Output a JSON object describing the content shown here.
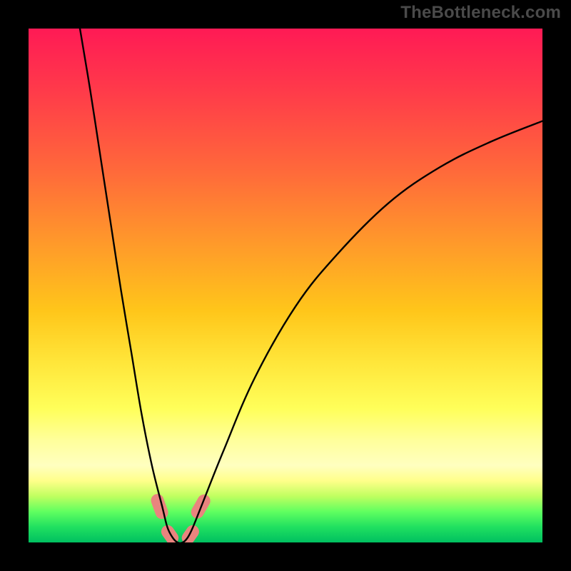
{
  "watermark": "TheBottleneck.com",
  "chart_data": {
    "type": "line",
    "title": "",
    "xlabel": "",
    "ylabel": "",
    "xlim": [
      0,
      100
    ],
    "ylim": [
      0,
      100
    ],
    "grid": false,
    "legend": false,
    "background_gradient": {
      "top_color": "#ff1a55",
      "mid_color": "#ffe63a",
      "bottom_color": "#00c060",
      "meaning": "red=high bottleneck, green=low bottleneck"
    },
    "series": [
      {
        "name": "bottleneck-curve",
        "color": "#000000",
        "x": [
          10,
          12,
          14,
          16,
          18,
          20,
          22,
          24,
          26,
          27,
          28,
          29,
          30,
          31,
          32,
          34,
          38,
          44,
          52,
          60,
          70,
          80,
          90,
          100
        ],
        "y": [
          100,
          88,
          75,
          62,
          49,
          37,
          25,
          15,
          7,
          3,
          1,
          0,
          0,
          1,
          3,
          8,
          18,
          32,
          46,
          56,
          66,
          73,
          78,
          82
        ]
      }
    ],
    "markers": [
      {
        "name": "highlight-left-slope",
        "shape": "round-bar",
        "color": "#e9847e",
        "x": 25.5,
        "y": 7,
        "angle_deg": 70,
        "length": 5
      },
      {
        "name": "highlight-valley-left",
        "shape": "round-bar",
        "color": "#e9847e",
        "x": 27.5,
        "y": 1.5,
        "angle_deg": 55,
        "length": 4
      },
      {
        "name": "highlight-valley-right",
        "shape": "round-bar",
        "color": "#e9847e",
        "x": 31.5,
        "y": 1.5,
        "angle_deg": -55,
        "length": 4
      },
      {
        "name": "highlight-right-slope",
        "shape": "round-bar",
        "color": "#e9847e",
        "x": 33.5,
        "y": 7,
        "angle_deg": -60,
        "length": 5
      }
    ]
  }
}
